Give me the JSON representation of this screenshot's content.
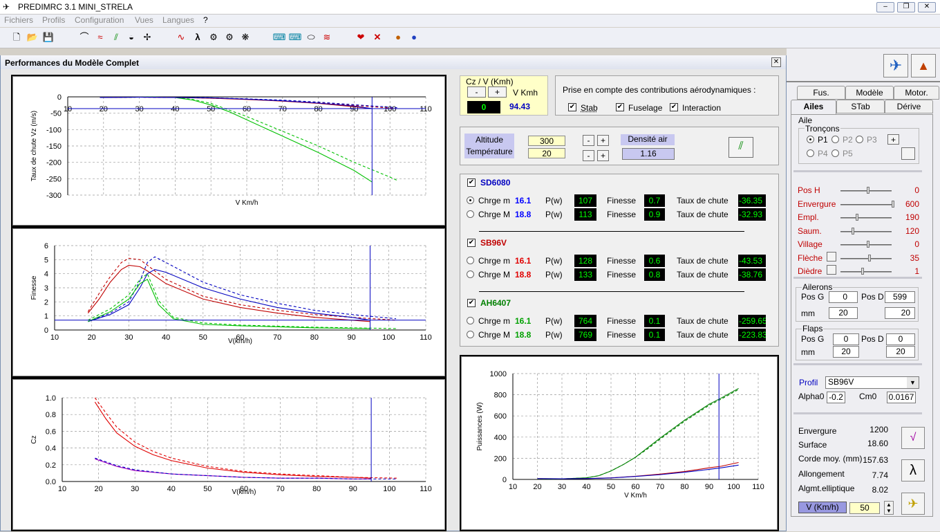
{
  "app": {
    "title": "PREDIMRC 3.1 MINI_STRELA",
    "win_buttons": [
      "–",
      "❐",
      "✕"
    ]
  },
  "menu": [
    "Fichiers",
    "Profils",
    "Configuration",
    "Vues",
    "Langues",
    "?"
  ],
  "window": {
    "title": "Performances du Modèle Complet",
    "close": "✕"
  },
  "czv": {
    "title": "Cz / V (Kmh)",
    "minus": "-",
    "plus": "+",
    "unit": "V Kmh",
    "value1": "0",
    "value2": "94.43"
  },
  "aero": {
    "title": "Prise en compte des contributions aérodynamiques :",
    "stab": "Stab",
    "fuselage": "Fuselage",
    "interaction": "Interaction"
  },
  "atm": {
    "altitude_label": "Altitude",
    "temperature_label": "Température",
    "altitude": "300",
    "temperature": "20",
    "density_label": "Densité air",
    "density": "1.16",
    "minus": "-",
    "plus": "+"
  },
  "profiles": [
    {
      "name": "SD6080",
      "color": "#0000c0",
      "rows": [
        {
          "label": "Chrge m",
          "charge": "16.1",
          "ccolor": "#0000ff",
          "p": "107",
          "f": "0.7",
          "tc": "-36.35",
          "selected": true
        },
        {
          "label": "Chrge M",
          "charge": "18.8",
          "ccolor": "#0000ff",
          "p": "113",
          "f": "0.9",
          "tc": "-32.93",
          "selected": false
        }
      ]
    },
    {
      "name": "SB96V",
      "color": "#c00000",
      "rows": [
        {
          "label": "Chrge m",
          "charge": "16.1",
          "ccolor": "#e00000",
          "p": "128",
          "f": "0.6",
          "tc": "-43.53",
          "selected": false
        },
        {
          "label": "Chrge M",
          "charge": "18.8",
          "ccolor": "#e00000",
          "p": "133",
          "f": "0.8",
          "tc": "-38.76",
          "selected": false
        }
      ]
    },
    {
      "name": "AH6407",
      "color": "#008000",
      "rows": [
        {
          "label": "Chrge m",
          "charge": "16.1",
          "ccolor": "#00a000",
          "p": "764",
          "f": "0.1",
          "tc": "-259.65",
          "selected": false
        },
        {
          "label": "Chrge M",
          "charge": "18.8",
          "ccolor": "#00a000",
          "p": "769",
          "f": "0.1",
          "tc": "-223.83",
          "selected": false
        }
      ]
    }
  ],
  "row_labels": {
    "p": "P(w)",
    "finesse": "Finesse",
    "taux": "Taux de chute"
  },
  "right": {
    "tabs_top": [
      "Fus.",
      "Modèle",
      "Motor."
    ],
    "tabs_bottom": [
      "Ailes",
      "STab",
      "Dérive"
    ],
    "aile": "Aile",
    "troncons": "Tronçons",
    "p_radios": [
      "P1",
      "P2",
      "P3",
      "P4",
      "P5"
    ],
    "plus": "+",
    "sliders": [
      {
        "label": "Pos H",
        "value": "0"
      },
      {
        "label": "Envergure",
        "value": "600"
      },
      {
        "label": "Empl.",
        "value": "190"
      },
      {
        "label": "Saum.",
        "value": "120"
      },
      {
        "label": "Village",
        "value": "0"
      },
      {
        "label": "Flèche",
        "value": "35"
      },
      {
        "label": "Dièdre",
        "value": "1"
      }
    ],
    "ailerons": {
      "title": "Ailerons",
      "posg": "Pos G",
      "posd": "Pos D",
      "mm": "mm",
      "g": "0",
      "d": "599",
      "mmg": "20",
      "mmd": "20"
    },
    "flaps": {
      "title": "Flaps",
      "posg": "Pos G",
      "posd": "Pos D",
      "mm": "mm",
      "g": "0",
      "d": "0",
      "mmg": "20",
      "mmd": "20"
    },
    "profil_label": "Profil",
    "profil": "SB96V",
    "alpha0_label": "Alpha0",
    "alpha0": "-0.2",
    "cm0_label": "Cm0",
    "cm0": "0.0167",
    "stats": [
      {
        "label": "Envergure",
        "value": "1200"
      },
      {
        "label": "Surface",
        "value": "18.60"
      },
      {
        "label": "Corde moy. (mm)",
        "value": "157.63"
      },
      {
        "label": "Allongement",
        "value": "7.74"
      },
      {
        "label": "Algmt.elliptique",
        "value": "8.02"
      }
    ],
    "v_label": "V (Km/h)",
    "v_value": "50",
    "lambda": "λ"
  },
  "chart_data": [
    {
      "type": "line",
      "id": "vz",
      "ylabel": "Taux de chute Vz (m/s)",
      "xlabel": "V Km/h",
      "xlim": [
        10,
        110
      ],
      "ylim": [
        -300,
        0
      ],
      "xticks": [
        10,
        20,
        30,
        40,
        50,
        60,
        70,
        80,
        90,
        100,
        110
      ],
      "yticks": [
        0,
        -50,
        -100,
        -150,
        -200,
        -250,
        -300
      ],
      "marker_x": 95,
      "hline": -36,
      "series": [
        {
          "color": "#00c000",
          "dash": false,
          "x": [
            19,
            25,
            30,
            35,
            40,
            45,
            50,
            55,
            60,
            70,
            80,
            90,
            95
          ],
          "y": [
            -2,
            -1.5,
            -1,
            -1,
            -2,
            -10,
            -25,
            -45,
            -70,
            -120,
            -170,
            -225,
            -260
          ]
        },
        {
          "color": "#00c000",
          "dash": true,
          "x": [
            19,
            25,
            30,
            35,
            40,
            45,
            50,
            55,
            60,
            70,
            80,
            90,
            100,
            102
          ],
          "y": [
            -2,
            -1.5,
            -1,
            -1,
            -2,
            -8,
            -20,
            -40,
            -60,
            -105,
            -150,
            -200,
            -245,
            -255
          ]
        },
        {
          "color": "#c00000",
          "dash": false,
          "x": [
            19,
            30,
            40,
            50,
            60,
            70,
            80,
            90,
            95
          ],
          "y": [
            -2,
            -1,
            -2,
            -4,
            -8,
            -13,
            -20,
            -30,
            -36
          ]
        },
        {
          "color": "#c00000",
          "dash": true,
          "x": [
            19,
            30,
            40,
            50,
            60,
            70,
            80,
            90,
            102
          ],
          "y": [
            -2,
            -1,
            -2,
            -4,
            -7,
            -12,
            -18,
            -26,
            -36
          ]
        },
        {
          "color": "#0000c0",
          "dash": false,
          "x": [
            19,
            30,
            40,
            50,
            60,
            70,
            80,
            90,
            95
          ],
          "y": [
            -2,
            -1,
            -2,
            -3,
            -7,
            -12,
            -19,
            -28,
            -36
          ]
        },
        {
          "color": "#0000c0",
          "dash": true,
          "x": [
            19,
            30,
            40,
            50,
            60,
            70,
            80,
            90,
            102
          ],
          "y": [
            -2,
            -1,
            -2,
            -3,
            -6,
            -10,
            -16,
            -24,
            -33
          ]
        }
      ]
    },
    {
      "type": "line",
      "id": "finesse",
      "ylabel": "Finesse",
      "xlabel": "V(km/h)",
      "xlim": [
        10,
        110
      ],
      "ylim": [
        0,
        6
      ],
      "xticks": [
        10,
        20,
        30,
        40,
        50,
        60,
        70,
        80,
        90,
        100,
        110
      ],
      "yticks": [
        0,
        1,
        2,
        3,
        4,
        5,
        6
      ],
      "marker_x": 95,
      "hline": 0.7,
      "series": [
        {
          "color": "#c00000",
          "dash": false,
          "x": [
            19,
            22,
            25,
            28,
            30,
            33,
            35,
            40,
            50,
            60,
            70,
            80,
            90,
            95
          ],
          "y": [
            1.2,
            2.2,
            3.4,
            4.3,
            4.6,
            4.5,
            4.2,
            3.3,
            2.2,
            1.6,
            1.2,
            0.9,
            0.7,
            0.6
          ]
        },
        {
          "color": "#c00000",
          "dash": true,
          "x": [
            19,
            22,
            25,
            28,
            30,
            33,
            35,
            40,
            50,
            60,
            70,
            80,
            90,
            102
          ],
          "y": [
            1.3,
            2.6,
            3.8,
            4.8,
            5.1,
            5.0,
            4.6,
            3.6,
            2.4,
            1.8,
            1.4,
            1.1,
            0.9,
            0.7
          ]
        },
        {
          "color": "#0000c0",
          "dash": false,
          "x": [
            19,
            25,
            30,
            33,
            35,
            37,
            40,
            50,
            60,
            70,
            80,
            90,
            95
          ],
          "y": [
            0.6,
            1.1,
            1.8,
            3.0,
            4.0,
            4.3,
            4.1,
            3.0,
            2.2,
            1.6,
            1.2,
            0.9,
            0.7
          ]
        },
        {
          "color": "#0000c0",
          "dash": true,
          "x": [
            19,
            25,
            30,
            33,
            35,
            37,
            40,
            50,
            60,
            70,
            80,
            90,
            102
          ],
          "y": [
            0.6,
            1.2,
            2.0,
            3.5,
            4.8,
            5.2,
            4.8,
            3.4,
            2.5,
            1.9,
            1.4,
            1.1,
            0.8
          ]
        },
        {
          "color": "#00c000",
          "dash": false,
          "x": [
            19,
            25,
            30,
            33,
            35,
            38,
            42,
            50,
            60,
            80,
            95
          ],
          "y": [
            0.6,
            1.3,
            2.2,
            3.3,
            3.6,
            1.8,
            0.8,
            0.4,
            0.3,
            0.15,
            0.1
          ]
        },
        {
          "color": "#00c000",
          "dash": true,
          "x": [
            19,
            25,
            30,
            33,
            35,
            38,
            42,
            50,
            60,
            80,
            102
          ],
          "y": [
            0.7,
            1.5,
            2.5,
            3.6,
            4.0,
            2.1,
            0.9,
            0.5,
            0.35,
            0.2,
            0.1
          ]
        }
      ]
    },
    {
      "type": "line",
      "id": "cz",
      "ylabel": "Cz",
      "xlabel": "V(km/h)",
      "xlim": [
        10,
        110
      ],
      "ylim": [
        0,
        1.0
      ],
      "xticks": [
        10,
        20,
        30,
        40,
        50,
        60,
        70,
        80,
        90,
        100,
        110
      ],
      "yticks": [
        0.0,
        0.2,
        0.4,
        0.6,
        0.8,
        1.0
      ],
      "marker_x": 95,
      "series": [
        {
          "color": "#e00000",
          "dash": false,
          "x": [
            19,
            22,
            25,
            30,
            35,
            40,
            50,
            60,
            70,
            80,
            90,
            95
          ],
          "y": [
            0.95,
            0.75,
            0.58,
            0.42,
            0.32,
            0.25,
            0.16,
            0.11,
            0.08,
            0.06,
            0.05,
            0.04
          ]
        },
        {
          "color": "#e00000",
          "dash": true,
          "x": [
            19,
            22,
            25,
            30,
            35,
            40,
            50,
            60,
            70,
            80,
            90,
            102
          ],
          "y": [
            1.0,
            0.82,
            0.65,
            0.47,
            0.36,
            0.28,
            0.18,
            0.12,
            0.09,
            0.07,
            0.05,
            0.04
          ]
        },
        {
          "color": "#a000c0",
          "dash": false,
          "x": [
            19,
            25,
            30,
            40,
            50,
            60,
            70,
            80,
            90,
            95
          ],
          "y": [
            0.27,
            0.18,
            0.13,
            0.09,
            0.07,
            0.05,
            0.04,
            0.04,
            0.03,
            0.03
          ]
        },
        {
          "color": "#0000c0",
          "dash": true,
          "x": [
            19,
            25,
            30,
            40,
            50,
            60,
            70,
            80,
            90,
            102
          ],
          "y": [
            0.28,
            0.19,
            0.14,
            0.09,
            0.07,
            0.05,
            0.04,
            0.04,
            0.03,
            0.03
          ]
        }
      ]
    },
    {
      "type": "line",
      "id": "puissance",
      "ylabel": "Puissances (W)",
      "xlabel": "V Km/h",
      "xlim": [
        10,
        110
      ],
      "ylim": [
        0,
        1000
      ],
      "xticks": [
        10,
        20,
        30,
        40,
        50,
        60,
        70,
        80,
        90,
        100,
        110
      ],
      "yticks": [
        0,
        200,
        400,
        600,
        800,
        1000
      ],
      "marker_x": 94,
      "series": [
        {
          "color": "#008000",
          "dash": false,
          "x": [
            20,
            30,
            40,
            45,
            50,
            55,
            60,
            65,
            70,
            80,
            90,
            95,
            102
          ],
          "y": [
            5,
            5,
            15,
            35,
            80,
            140,
            210,
            300,
            390,
            560,
            710,
            770,
            860
          ]
        },
        {
          "color": "#008000",
          "dash": true,
          "x": [
            20,
            30,
            40,
            45,
            50,
            55,
            60,
            65,
            70,
            80,
            90,
            95,
            102
          ],
          "y": [
            5,
            5,
            15,
            35,
            80,
            140,
            210,
            290,
            380,
            550,
            700,
            760,
            850
          ]
        },
        {
          "color": "#c00000",
          "dash": false,
          "x": [
            20,
            30,
            40,
            50,
            60,
            70,
            80,
            90,
            95,
            102
          ],
          "y": [
            8,
            6,
            8,
            15,
            30,
            50,
            75,
            110,
            125,
            160
          ]
        },
        {
          "color": "#0000c0",
          "dash": false,
          "x": [
            20,
            30,
            40,
            50,
            60,
            70,
            80,
            90,
            95,
            102
          ],
          "y": [
            8,
            6,
            8,
            14,
            28,
            45,
            68,
            95,
            110,
            135
          ]
        }
      ]
    }
  ]
}
